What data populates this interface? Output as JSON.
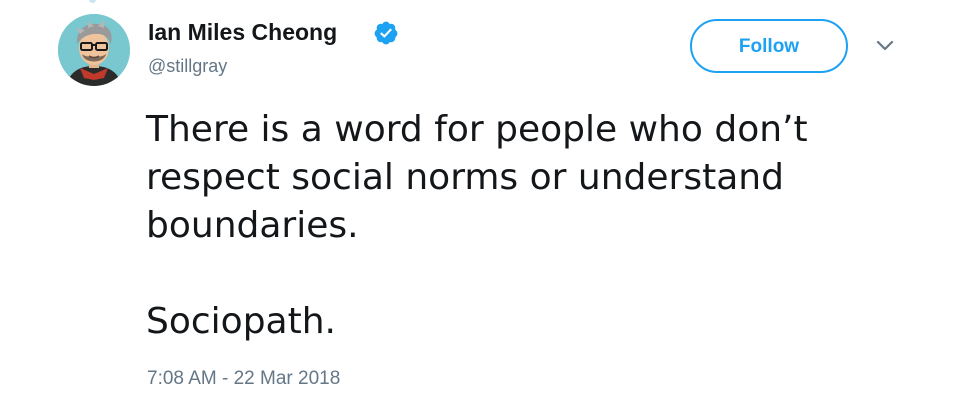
{
  "user": {
    "display_name": "Ian Miles Cheong",
    "handle": "@stillgray",
    "verified": true
  },
  "actions": {
    "follow_label": "Follow"
  },
  "tweet": {
    "lines": [
      "There is a word for people who don’t",
      "respect social norms or understand",
      "boundaries."
    ],
    "second_paragraph": "Sociopath.",
    "timestamp": "7:08 AM - 22 Mar 2018"
  },
  "icons": {
    "verified": "verified-badge-icon",
    "caret": "chevron-down-icon",
    "avatar": "avatar-illustration"
  },
  "colors": {
    "accent": "#1da1f2",
    "text": "#14171a",
    "muted": "#657786",
    "avatar_background": "#79c7cf"
  }
}
